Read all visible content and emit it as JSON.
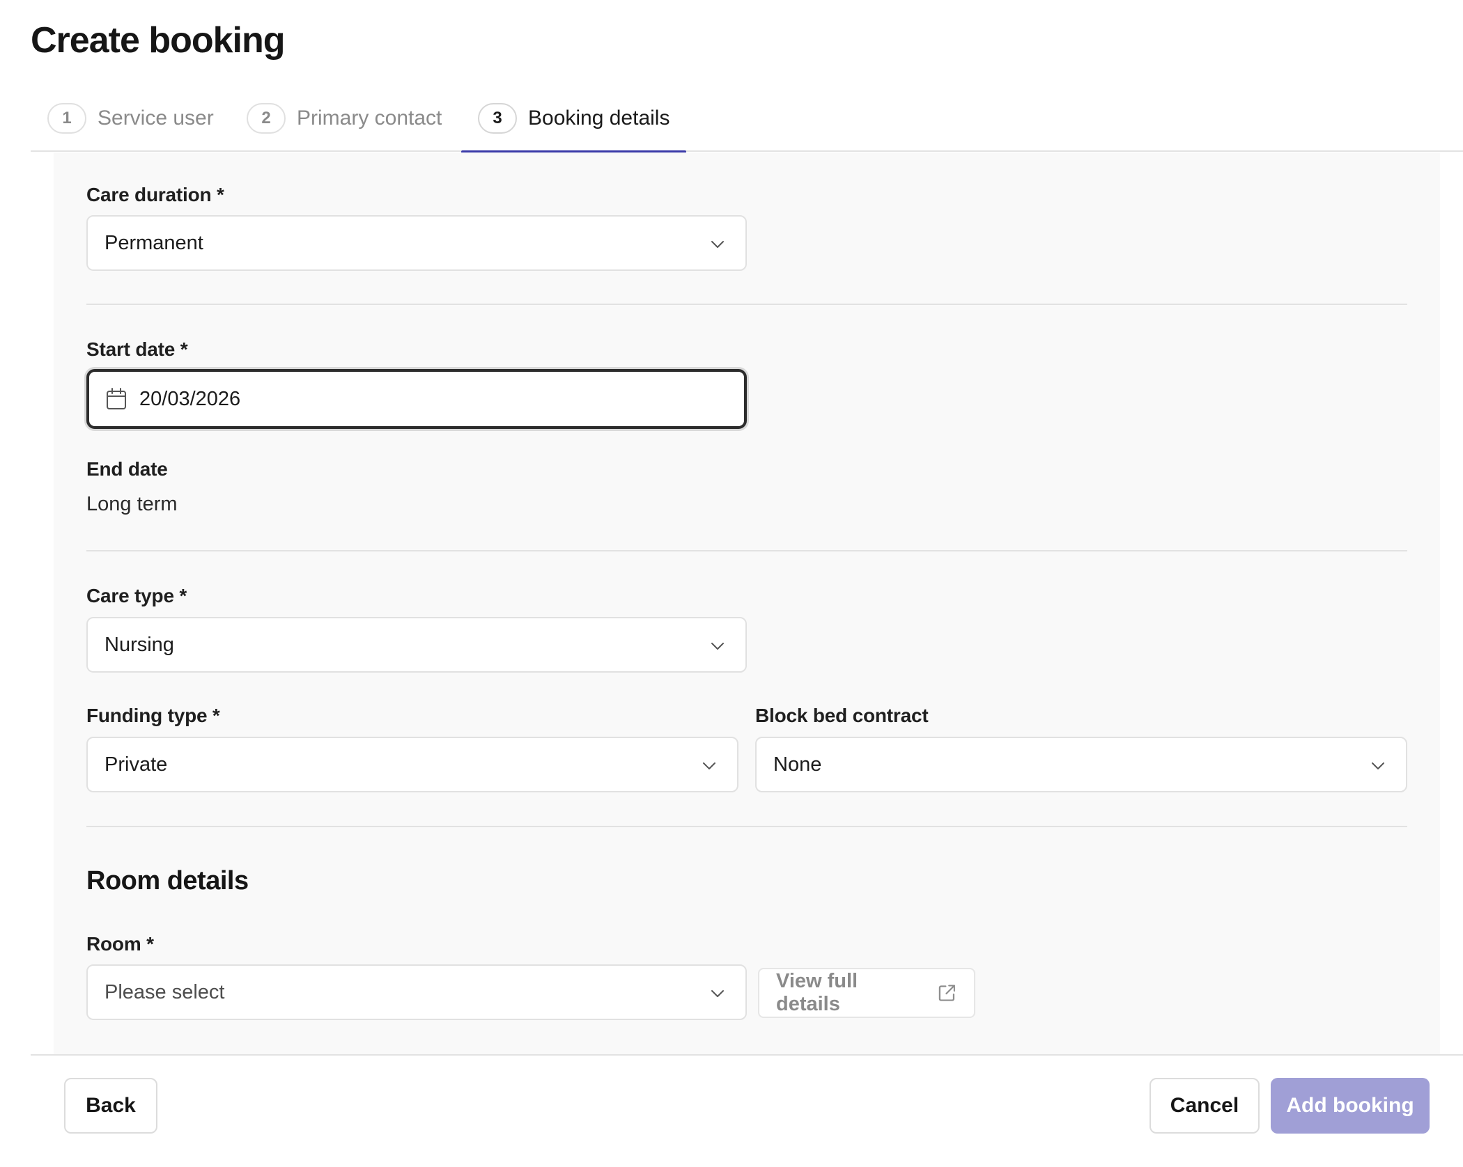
{
  "page": {
    "title": "Create booking"
  },
  "stepper": {
    "steps": [
      {
        "number": "1",
        "label": "Service user",
        "active": false
      },
      {
        "number": "2",
        "label": "Primary contact",
        "active": false
      },
      {
        "number": "3",
        "label": "Booking details",
        "active": true
      }
    ]
  },
  "form": {
    "care_duration": {
      "label": "Care duration *",
      "value": "Permanent"
    },
    "start_date": {
      "label": "Start date *",
      "value": "20/03/2026"
    },
    "end_date": {
      "label": "End date",
      "value": "Long term"
    },
    "care_type": {
      "label": "Care type *",
      "value": "Nursing"
    },
    "funding_type": {
      "label": "Funding type *",
      "value": "Private"
    },
    "block_bed_contract": {
      "label": "Block bed contract",
      "value": "None"
    },
    "room_details": {
      "title": "Room details",
      "room": {
        "label": "Room *",
        "placeholder": "Please select"
      },
      "view_full_details_label": "View full details"
    }
  },
  "footer": {
    "back_label": "Back",
    "cancel_label": "Cancel",
    "add_booking_label": "Add booking"
  },
  "colors": {
    "accent": "#3a3aa8",
    "primary_button_disabled": "#a09fd6",
    "content_background": "#f9f9f9"
  },
  "icons": {
    "select": "chevron-down-icon",
    "date": "calendar-icon",
    "link": "external-link-icon"
  }
}
